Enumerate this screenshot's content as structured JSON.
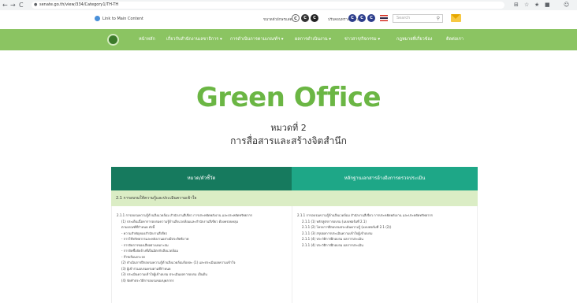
{
  "browser": {
    "url": "senate.go.th/view/334/Category1/TH-TH",
    "nav": [
      "←",
      "→",
      "C"
    ],
    "extensions": [
      "⊞",
      "☆",
      "★",
      "■",
      "☺"
    ]
  },
  "topbar": {
    "skip_link": "Link to Main Content",
    "font_size_label": "ขนาดตัวอักษรแสดงผล",
    "font_size_buttons": [
      "C",
      "C",
      "C"
    ],
    "contrast_label": "ปรับคอนทราสต์สีพื้นหลัง",
    "contrast_buttons": [
      "C",
      "C",
      "C"
    ],
    "search_placeholder": "Search"
  },
  "menu": {
    "items": [
      "หน้าหลัก",
      "เกี่ยวกับสำนักงานเลขาธิการ ▾",
      "การดำเนินการตามเกณฑ์ฯ ▾",
      "ผลการดำเนินงาน ▾",
      "ข่าวสาร/กิจกรรม ▾",
      "กฎหมายที่เกี่ยวข้อง",
      "ติดต่อเรา"
    ]
  },
  "hero": {
    "title": "Green Office",
    "category": "หมวดที่ 2",
    "subtitle": "การสื่อสารและสร้างจิตสำนึก"
  },
  "table": {
    "col1_header": "หมวด/ตัวชี้วัด",
    "col2_header": "หลักฐานเอกสารอ้างอิงการตรวจประเมิน",
    "section": "2.1 การอบรมให้ความรู้และประเมินความเข้าใจ",
    "left_lines": [
      "2.1.1 การอบรมความรู้ด้านสิ่งแวดล้อม สำนักงานสีเขียว การประหยัดพลังงาน และประหยัดทรัพยากร",
      "(1) ประเด็นเนื้อหาการอบรมความรู้ด้านสิ่งแวดล้อมและสำนักงานสีเขียว ต้องครอบคลุม",
      "ตามเกณฑ์ที่กำหนด ดังนี้",
      "- ความสำคัญของสำนักงานสีเขียว",
      "- การใช้ทรัพยากรและพลังงานอย่างมีประสิทธิภาพ",
      "- การจัดการของเสียอย่างเหมาะสม",
      "- การจัดซื้อจัดจ้างที่เป็นมิตรกับสิ่งแวดล้อม",
      "- ก๊าซเรือนกระจก",
      "(2) ดำเนินการฝึกอบรมความรู้ด้านสิ่งแวดล้อมร้อยละ (1) และประเมินผลความเข้าใจ",
      "(3) ผู้เข้าร่วมอบรมครบตามที่กำหนด",
      "(3) ประเมินความเข้าใจผู้เข้าอบรม ประเมินผลการอบรม เป็นต้น",
      "(4) จัดทำประวัติการอบรมของบุคลากร"
    ],
    "right_lines": [
      "2.1.1 การอบรมความรู้ด้านสิ่งแวดล้อม สำนักงานสีเขียว การประหยัดพลังงาน และประหยัดทรัพยากร",
      "2.1.1 (1) หลักสูตรการอบรม (แบบฟอร์มที่ 2.1)",
      "2.1.1 (2) โครงการฝึกอบรมประเมินความรู้ (แบบฟอร์มที่ 2.1 (2))",
      "2.1.1 (3) สรุปผลการประเมินความเข้าใจผู้เข้าอบรม",
      "2.1.1 (4) ประวัติการฝึกอบรม ผลการประเมิน",
      "2.1.1 (4) ประวัติการฝึกอบรม ผลการประเมิน"
    ]
  },
  "colors": {
    "menu_green": "#8bc462",
    "title_green": "#6bb644",
    "header_dark": "#167a5e",
    "header_teal": "#1ea787",
    "section_bg": "#dbedc5"
  }
}
